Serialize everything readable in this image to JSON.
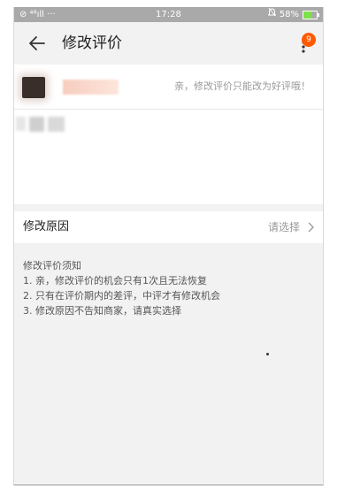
{
  "status_bar": {
    "left_indicators": "⊘ ⁴⁶ıll ···",
    "time": "17:28",
    "battery_percent": "58%",
    "battery_level": 0.58
  },
  "nav": {
    "title": "修改评价",
    "badge_count": "9",
    "back_icon": "arrow-left-icon",
    "more_icon": "more-vertical-icon"
  },
  "review": {
    "tip": "亲，修改评价只能改为好评哦！"
  },
  "reason": {
    "label": "修改原因",
    "placeholder": "请选择"
  },
  "notice": {
    "title": "修改评价须知",
    "items": [
      "1. 亲，修改评价的机会只有1次且无法恢复",
      "2. 只有在评价期内的差评，中评才有修改机会",
      "3. 修改原因不告知商家，请真实选择"
    ]
  },
  "colors": {
    "accent": "#ff5a00",
    "status_bar_bg": "#a9a9a9",
    "battery_fill": "#7ee04a"
  }
}
